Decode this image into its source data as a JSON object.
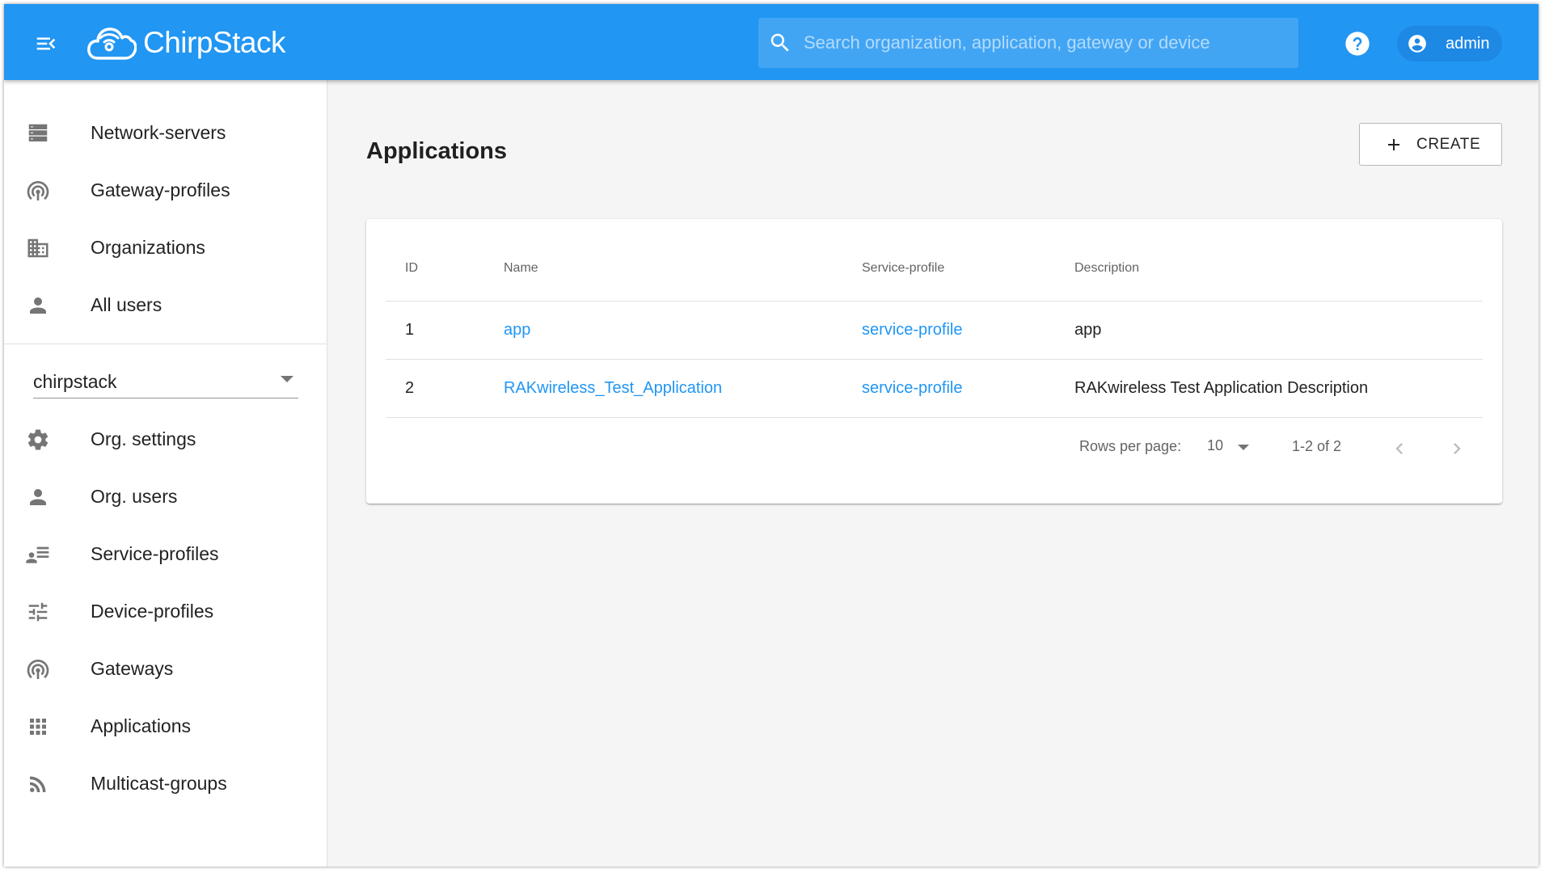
{
  "header": {
    "brand": "ChirpStack",
    "search_placeholder": "Search organization, application, gateway or device",
    "user": "admin",
    "colors": {
      "primary": "#2196f3",
      "chip": "#1e88e5"
    }
  },
  "sidebar": {
    "admin_items": [
      {
        "label": "Network-servers",
        "icon": "dns-icon"
      },
      {
        "label": "Gateway-profiles",
        "icon": "gateway-icon"
      },
      {
        "label": "Organizations",
        "icon": "domain-icon"
      },
      {
        "label": "All users",
        "icon": "person-icon"
      }
    ],
    "org_select": "chirpstack",
    "org_items": [
      {
        "label": "Org. settings",
        "icon": "gear-icon"
      },
      {
        "label": "Org. users",
        "icon": "person-icon"
      },
      {
        "label": "Service-profiles",
        "icon": "account-details-icon"
      },
      {
        "label": "Device-profiles",
        "icon": "tune-icon"
      },
      {
        "label": "Gateways",
        "icon": "gateway-icon"
      },
      {
        "label": "Applications",
        "icon": "apps-icon"
      },
      {
        "label": "Multicast-groups",
        "icon": "rss-icon"
      }
    ]
  },
  "main": {
    "title": "Applications",
    "create_label": "CREATE",
    "table": {
      "columns": [
        "ID",
        "Name",
        "Service-profile",
        "Description"
      ],
      "rows": [
        [
          "1",
          "app",
          "service-profile",
          "app"
        ],
        [
          "2",
          "RAKwireless_Test_Application",
          "service-profile",
          "RAKwireless Test Application Description"
        ]
      ]
    },
    "pagination": {
      "rows_per_page_label": "Rows per page:",
      "rows_per_page": "10",
      "range": "1-2 of 2"
    },
    "link_color": "#2196f3"
  }
}
